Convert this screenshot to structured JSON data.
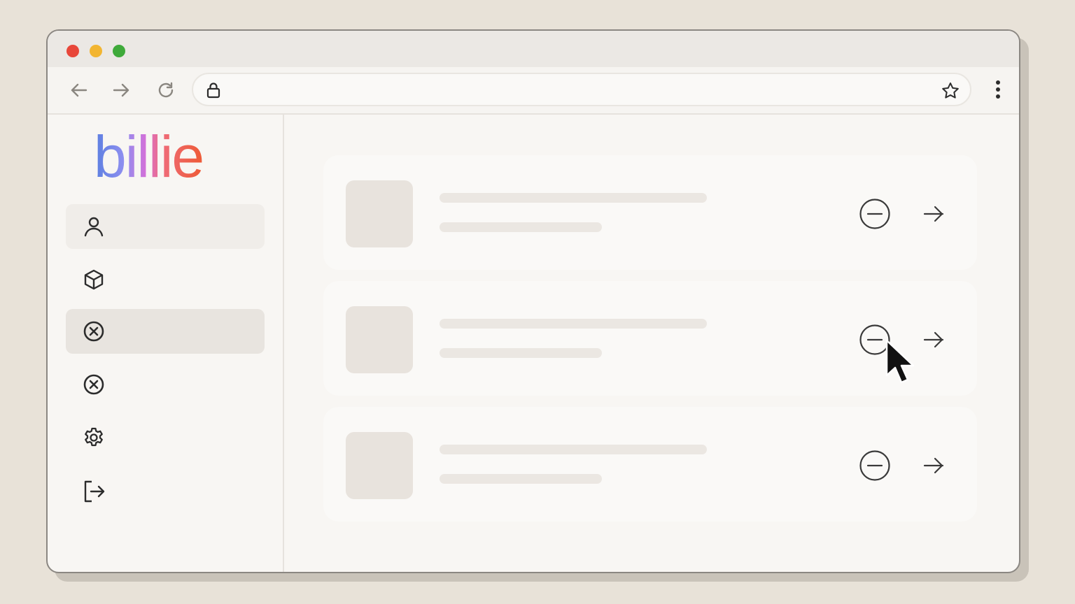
{
  "window": {
    "controls": [
      "close",
      "minimize",
      "maximize"
    ]
  },
  "toolbar": {
    "back_icon": "arrow-left-icon",
    "forward_icon": "arrow-right-icon",
    "reload_icon": "reload-icon",
    "address_icon": "lock-icon",
    "address_value": "",
    "bookmark_icon": "star-icon",
    "menu_icon": "more-vertical-icon"
  },
  "sidebar": {
    "logo_text": "billie",
    "logo_colors": [
      "#5b7fe0",
      "#8f8ff0",
      "#d56fd8",
      "#ef6c7a",
      "#f08a6e",
      "#ee5a35"
    ],
    "items": [
      {
        "icon": "user-icon",
        "state": "hover"
      },
      {
        "icon": "box-icon",
        "state": "default"
      },
      {
        "icon": "x-circle-icon",
        "state": "selected"
      },
      {
        "icon": "x-circle-icon",
        "state": "default"
      },
      {
        "icon": "gear-icon",
        "state": "default"
      },
      {
        "icon": "logout-icon",
        "state": "default"
      }
    ]
  },
  "main": {
    "rows": [
      {
        "thumb": "placeholder",
        "actions": [
          "minus-circle-icon",
          "arrow-right-icon"
        ]
      },
      {
        "thumb": "placeholder",
        "actions": [
          "minus-circle-icon",
          "arrow-right-icon"
        ]
      },
      {
        "thumb": "placeholder",
        "actions": [
          "minus-circle-icon",
          "arrow-right-icon"
        ]
      }
    ]
  },
  "colors": {
    "background": "#e8e2d8",
    "window": "#f8f6f3",
    "card": "#faf9f7",
    "placeholder": "#e8e3dd",
    "icon": "#2c2c2c"
  }
}
